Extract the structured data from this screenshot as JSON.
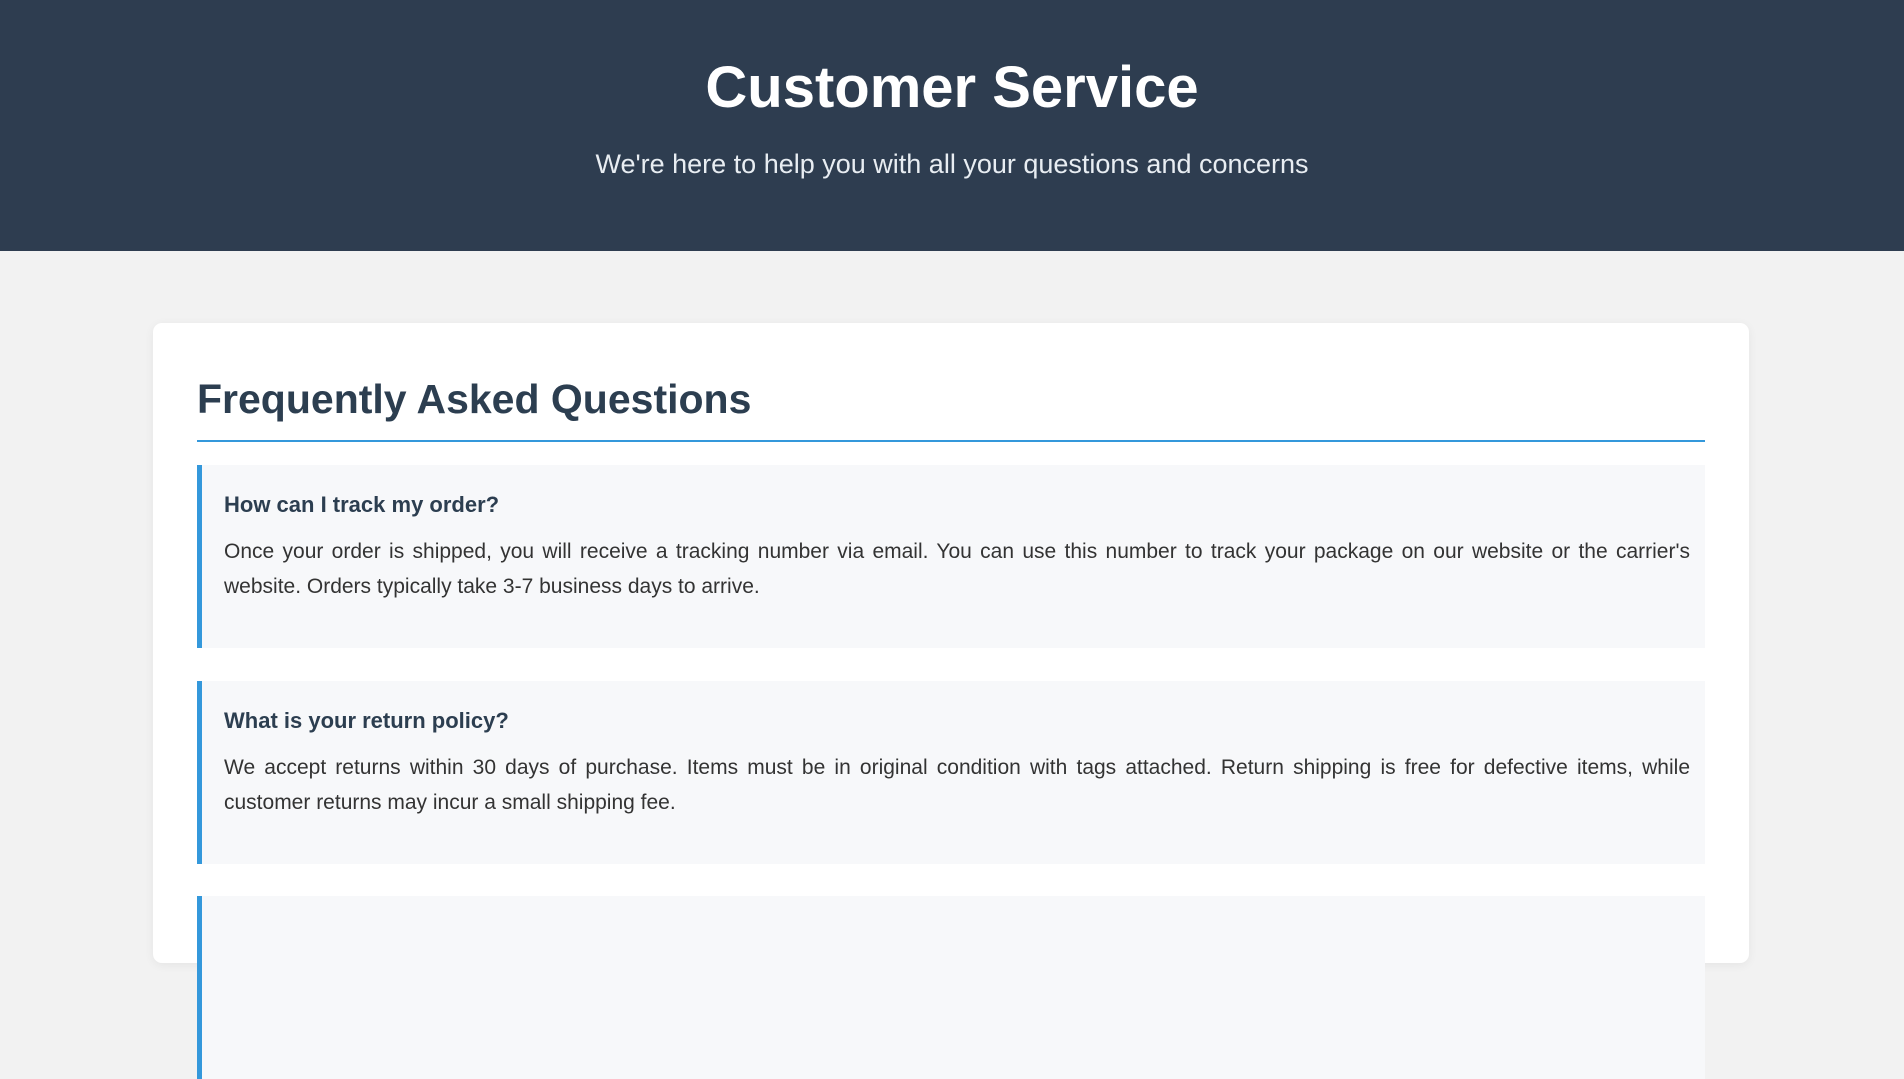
{
  "header": {
    "title": "Customer Service",
    "subtitle": "We're here to help you with all your questions and concerns"
  },
  "faq": {
    "heading": "Frequently Asked Questions",
    "items": [
      {
        "question": "How can I track my order?",
        "answer": "Once your order is shipped, you will receive a tracking number via email. You can use this number to track your package on our website or the carrier's website. Orders typically take 3-7 business days to arrive."
      },
      {
        "question": "What is your return policy?",
        "answer": "We accept returns within 30 days of purchase. Items must be in original condition with tags attached. Return shipping is free for defective items, while customer returns may incur a small shipping fee."
      }
    ]
  },
  "colors": {
    "header_bg": "#2e3d50",
    "accent": "#3498db",
    "page_bg": "#f2f2f2",
    "heading_text": "#2c3e50"
  }
}
